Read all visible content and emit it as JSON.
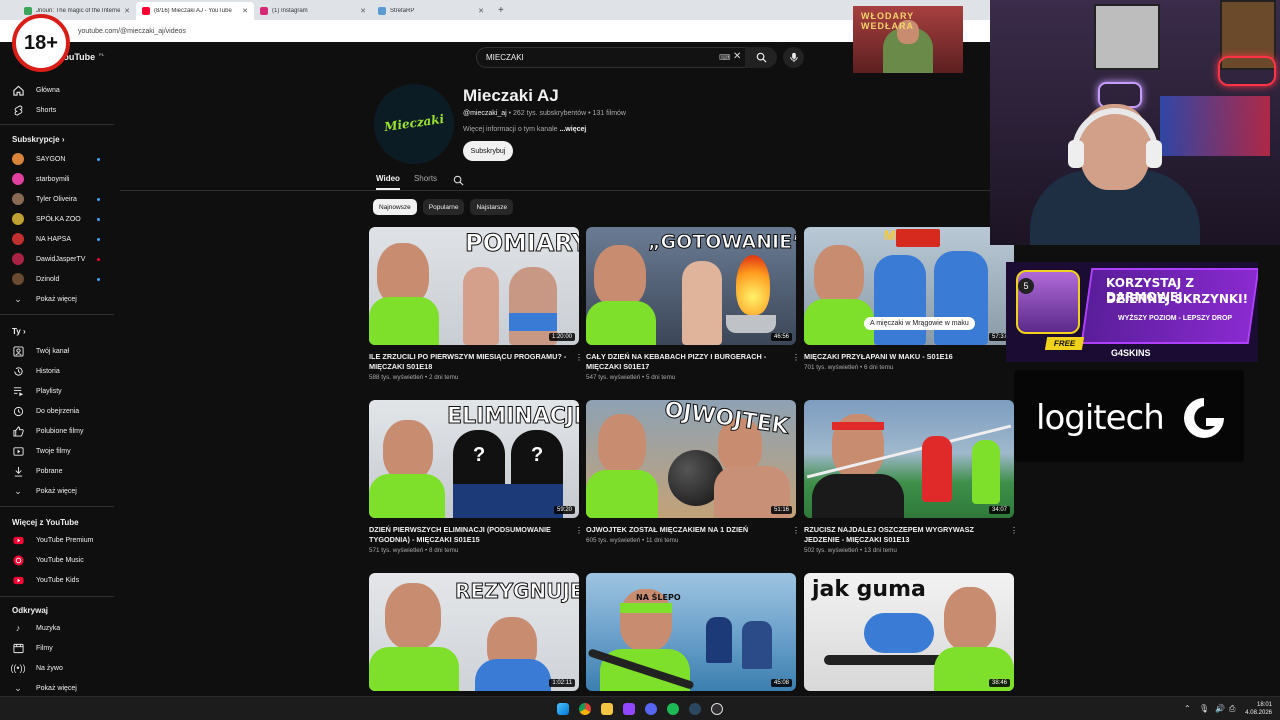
{
  "browser": {
    "tabs": [
      {
        "title": "Jnoun: The magic of the Internet",
        "color": "#3ca55c"
      },
      {
        "title": "(8/16) Mieczaki AJ - YouTube",
        "color": "#ff0033"
      },
      {
        "title": "(1) Instagram",
        "color": "#d62976"
      },
      {
        "title": "StrefaRP",
        "color": "#5a9bd4"
      }
    ],
    "url": "youtube.com/@mieczaki_aj/videos"
  },
  "overlay": {
    "age_badge": "18+",
    "banner_text": "WŁODARY WEDŁARA"
  },
  "sidebar": {
    "logo": "YouTube",
    "logo_region": "PL",
    "main": [
      {
        "label": "Główna",
        "icon": "home-icon"
      },
      {
        "label": "Shorts",
        "icon": "shorts-icon"
      }
    ],
    "subs_title": "Subskrypcje",
    "subs": [
      {
        "label": "SAYGON",
        "color": "#d8843a",
        "dot": true
      },
      {
        "label": "starboymili",
        "color": "#e040a0",
        "dot": false
      },
      {
        "label": "Tyler Oliveira",
        "color": "#8a6a55",
        "dot": true
      },
      {
        "label": "SPÓŁKA ZOO",
        "color": "#c0a030",
        "dot": true
      },
      {
        "label": "NA HAPSA",
        "color": "#c03030",
        "dot": true
      },
      {
        "label": "DawidJasperTV",
        "color": "#aa2244",
        "dot": true
      },
      {
        "label": "Dzinold",
        "color": "#6a4a30",
        "dot": true
      }
    ],
    "subs_more": "Pokaż więcej",
    "you_title": "Ty",
    "you": [
      {
        "label": "Twój kanał",
        "icon": "channel-icon"
      },
      {
        "label": "Historia",
        "icon": "history-icon"
      },
      {
        "label": "Playlisty",
        "icon": "playlist-icon"
      },
      {
        "label": "Do obejrzenia",
        "icon": "watch-later-icon"
      },
      {
        "label": "Polubione filmy",
        "icon": "like-icon"
      },
      {
        "label": "Twoje filmy",
        "icon": "your-videos-icon"
      },
      {
        "label": "Pobrane",
        "icon": "download-icon"
      },
      {
        "label": "Pokaż więcej",
        "icon": "chevron-down-icon"
      }
    ],
    "more_title": "Więcej z YouTube",
    "more": [
      {
        "label": "YouTube Premium"
      },
      {
        "label": "YouTube Music"
      },
      {
        "label": "YouTube Kids"
      }
    ],
    "explore_title": "Odkrywaj",
    "explore": [
      {
        "label": "Muzyka",
        "icon": "music-icon"
      },
      {
        "label": "Filmy",
        "icon": "film-icon"
      },
      {
        "label": "Na żywo",
        "icon": "live-icon"
      },
      {
        "label": "Pokaż więcej",
        "icon": "chevron-down-icon"
      }
    ]
  },
  "search": {
    "query": "MIECZAKI"
  },
  "channel": {
    "name": "Mieczaki AJ",
    "handle": "@mieczaki_aj",
    "stats": " • 262 tys. subskrybentów • 131 filmów",
    "more_info": "Więcej informacji o tym kanale",
    "more_link": " ...więcej",
    "subscribe": "Subskrybuj",
    "avatar_text": "Mieczaki",
    "tabs": [
      "Wideo",
      "Shorts"
    ],
    "chips": [
      "Najnowsze",
      "Popularne",
      "Najstarsze"
    ]
  },
  "videos": [
    {
      "title": "ILE ZRZUCILI PO PIERWSZYM MIESIĄCU PROGRAMU? - MIĘCZAKI S01E18",
      "meta": "588 tys. wyświetleń • 2 dni temu",
      "duration": "1:20:00",
      "thumb_text": "POMIARY",
      "bg": "#d9dde2"
    },
    {
      "title": "CAŁY DZIEŃ NA KEBABACH PIZZY I BURGERACH - MIĘCZAKI S01E17",
      "meta": "547 tys. wyświetleń • 5 dni temu",
      "duration": "46:56",
      "thumb_text": "„GOTOWANIE”",
      "bg": "#5a6f8a"
    },
    {
      "title": "MIĘCZAKI PRZYŁAPANI W MAKU - S01E16",
      "meta": "701 tys. wyświetleń • 6 dni temu",
      "duration": "57:37",
      "thumb_text": "A mięczaki w Mrągowie w maku",
      "bg": "#a6b8c8"
    },
    {
      "title": "DZIEŃ PIERWSZYCH ELIMINACJI (PODSUMOWANIE TYGODNIA) - MIĘCZAKI S01E15",
      "meta": "571 tys. wyświetleń • 8 dni temu",
      "duration": "59:20",
      "thumb_text": "ELIMINACJE",
      "bg": "#cfd3d8"
    },
    {
      "title": "OJWOJTEK ZOSTAŁ MIĘCZAKIEM NA 1 DZIEŃ",
      "meta": "605 tys. wyświetleń • 11 dni temu",
      "duration": "51:16",
      "thumb_text": "OJWOJTEK",
      "bg": "#8a9aa8"
    },
    {
      "title": "RZUCISZ NAJDALEJ OSZCZEPEM WYGRYWASZ JEDZENIE - MIĘCZAKI S01E13",
      "meta": "502 tys. wyświetleń • 13 dni temu",
      "duration": "34:07",
      "thumb_text": "",
      "bg": "#7c96b0"
    },
    {
      "title": "",
      "meta": "",
      "duration": "1:02:11",
      "thumb_text": "REZYGNUJE?",
      "bg": "#dcdfe3"
    },
    {
      "title": "",
      "meta": "",
      "duration": "45:08",
      "thumb_text": "NA ŚLEPO",
      "bg": "#7ba7c8"
    },
    {
      "title": "",
      "meta": "",
      "duration": "38:46",
      "thumb_text": "jak guma",
      "bg": "#e8e8e8"
    }
  ],
  "promo": {
    "line1": "KORZYSTAJ Z DARMOWEJ",
    "line2": "DZIENNEJ SKRZYNKI!",
    "line3": "WYŻSZY POZIOM - LEPSZY DROP",
    "free": "FREE",
    "brand": "G4SKINS",
    "level": "5"
  },
  "sponsor": {
    "text": "logitech"
  },
  "taskbar": {
    "time": "18:01",
    "date": "4.08.2026"
  },
  "colors": {
    "accent": "#ff0033",
    "bg": "#0f0f0f",
    "link": "#3ea6ff"
  }
}
